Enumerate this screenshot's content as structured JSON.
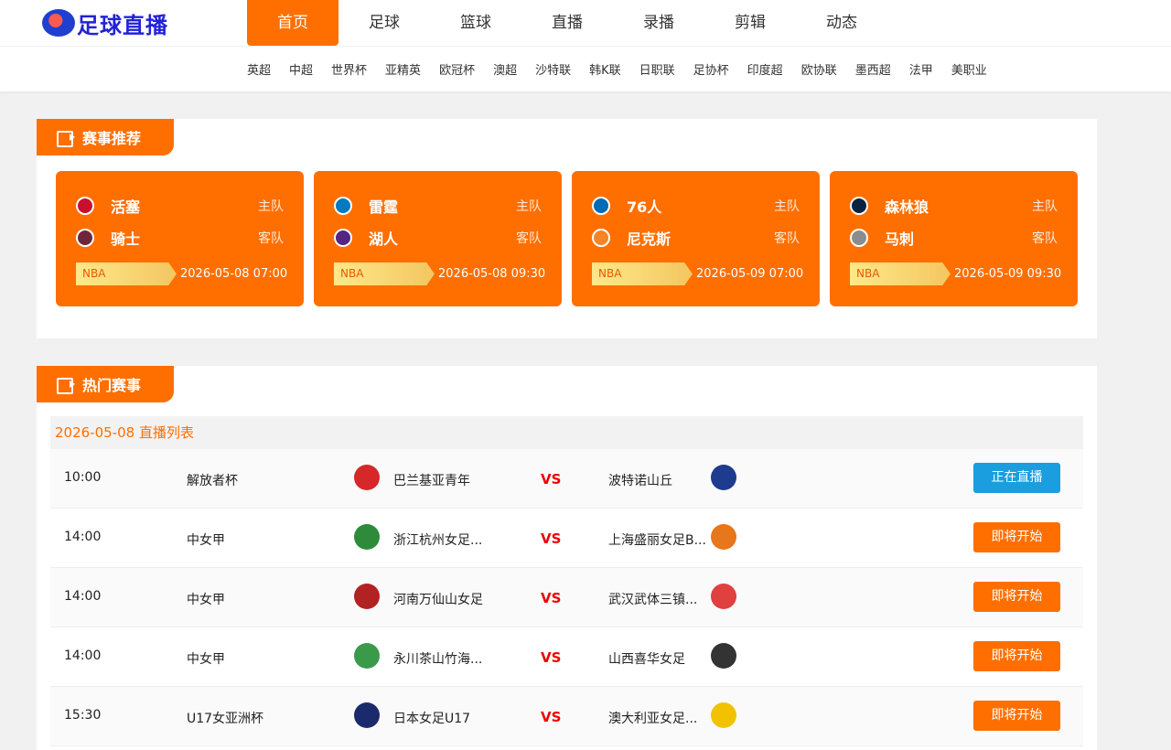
{
  "header": {
    "logo_text": "足球直播",
    "nav": [
      "首页",
      "足球",
      "篮球",
      "直播",
      "录播",
      "剪辑",
      "动态"
    ],
    "sub_nav": [
      "英超",
      "中超",
      "世界杯",
      "亚精英",
      "欧冠杯",
      "澳超",
      "沙特联",
      "韩K联",
      "日职联",
      "足协杯",
      "印度超",
      "欧协联",
      "墨西超",
      "法甲",
      "美职业"
    ]
  },
  "recommend": {
    "title": "赛事推荐",
    "cards": [
      {
        "home": "活塞",
        "home_role": "主队",
        "away": "骑士",
        "away_role": "客队",
        "league": "NBA",
        "time": "2026-05-08 07:00",
        "home_color": "#c8102e",
        "away_color": "#6f263d"
      },
      {
        "home": "雷霆",
        "home_role": "主队",
        "away": "湖人",
        "away_role": "客队",
        "league": "NBA",
        "time": "2026-05-08 09:30",
        "home_color": "#007ac1",
        "away_color": "#552583"
      },
      {
        "home": "76人",
        "home_role": "主队",
        "away": "尼克斯",
        "away_role": "客队",
        "league": "NBA",
        "time": "2026-05-09 07:00",
        "home_color": "#006bb6",
        "away_color": "#f58426"
      },
      {
        "home": "森林狼",
        "home_role": "主队",
        "away": "马刺",
        "away_role": "客队",
        "league": "NBA",
        "time": "2026-05-09 09:30",
        "home_color": "#0c2340",
        "away_color": "#8a8d8f"
      }
    ]
  },
  "hot": {
    "title": "热门赛事",
    "date_header": "2026-05-08 直播列表",
    "matches": [
      {
        "time": "10:00",
        "league": "解放者杯",
        "home": "巴兰基亚青年",
        "away": "波特诺山丘",
        "button": "正在直播",
        "live": true,
        "home_color": "#d62828",
        "away_color": "#1d3c8f"
      },
      {
        "time": "14:00",
        "league": "中女甲",
        "home": "浙江杭州女足...",
        "away": "上海盛丽女足B...",
        "button": "即将开始",
        "live": false,
        "home_color": "#2e8b3a",
        "away_color": "#e8761a"
      },
      {
        "time": "14:00",
        "league": "中女甲",
        "home": "河南万仙山女足",
        "away": "武汉武体三镇...",
        "button": "即将开始",
        "live": false,
        "home_color": "#b22222",
        "away_color": "#e04040"
      },
      {
        "time": "14:00",
        "league": "中女甲",
        "home": "永川茶山竹海...",
        "away": "山西喜华女足",
        "button": "即将开始",
        "live": false,
        "home_color": "#3a9a4a",
        "away_color": "#333333"
      },
      {
        "time": "15:30",
        "league": "U17女亚洲杯",
        "home": "日本女足U17",
        "away": "澳大利亚女足...",
        "button": "即将开始",
        "live": false,
        "home_color": "#1b2a6b",
        "away_color": "#f2c200"
      }
    ]
  }
}
